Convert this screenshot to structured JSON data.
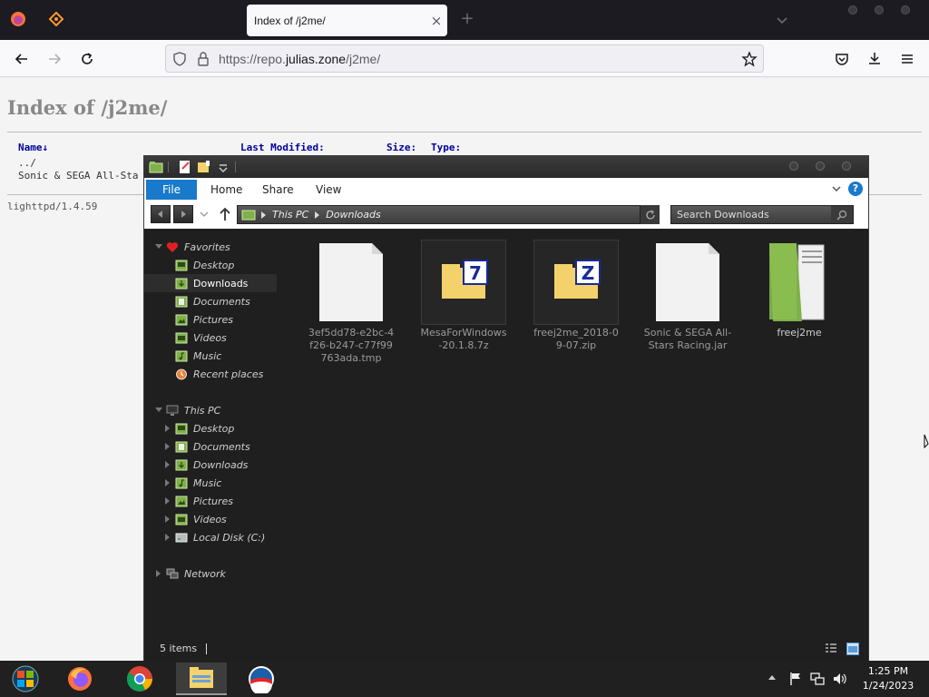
{
  "browser": {
    "tab_title": "Index of /j2me/",
    "tab_close": "×",
    "new_tab": "+",
    "url_prefix": "https://repo.",
    "url_host": "julias.zone",
    "url_suffix": "/j2me/"
  },
  "page": {
    "heading": "Index of /j2me/",
    "columns": {
      "name": "Name↓",
      "modified": "Last Modified:",
      "size": "Size:",
      "type": "Type:"
    },
    "rows": [
      "../",
      "Sonic & SEGA All-Sta"
    ],
    "footer": "lighttpd/1.4.59"
  },
  "explorer": {
    "ribbon": {
      "file": "File",
      "home": "Home",
      "share": "Share",
      "view": "View",
      "help": "?"
    },
    "breadcrumb": [
      "This PC",
      "Downloads"
    ],
    "search_placeholder": "Search Downloads",
    "nav": {
      "favorites": "Favorites",
      "fav_items": [
        "Desktop",
        "Downloads",
        "Documents",
        "Pictures",
        "Videos",
        "Music",
        "Recent places"
      ],
      "this_pc": "This PC",
      "pc_items": [
        "Desktop",
        "Documents",
        "Downloads",
        "Music",
        "Pictures",
        "Videos",
        "Local Disk (C:)"
      ],
      "network": "Network"
    },
    "files": [
      {
        "name": "3ef5dd78-e2bc-4f26-b247-c77f99763ada.tmp",
        "icon": "blank-file-icon"
      },
      {
        "name": "MesaForWindows-20.1.8.7z",
        "icon": "7zip-archive-icon"
      },
      {
        "name": "freej2me_2018-09-07.zip",
        "icon": "zip-archive-icon"
      },
      {
        "name": "Sonic & SEGA All-Stars Racing.jar",
        "icon": "blank-file-icon"
      },
      {
        "name": "freej2me",
        "icon": "green-folder-icon"
      }
    ],
    "status": "5 items"
  },
  "taskbar": {
    "time": "1:25 PM",
    "date": "1/24/2023"
  },
  "colors": {
    "ribbon_accent": "#1979ca",
    "explorer_bg": "#1f1f1f",
    "taskbar_bg": "#202020",
    "folder_green": "#7fb04a"
  }
}
